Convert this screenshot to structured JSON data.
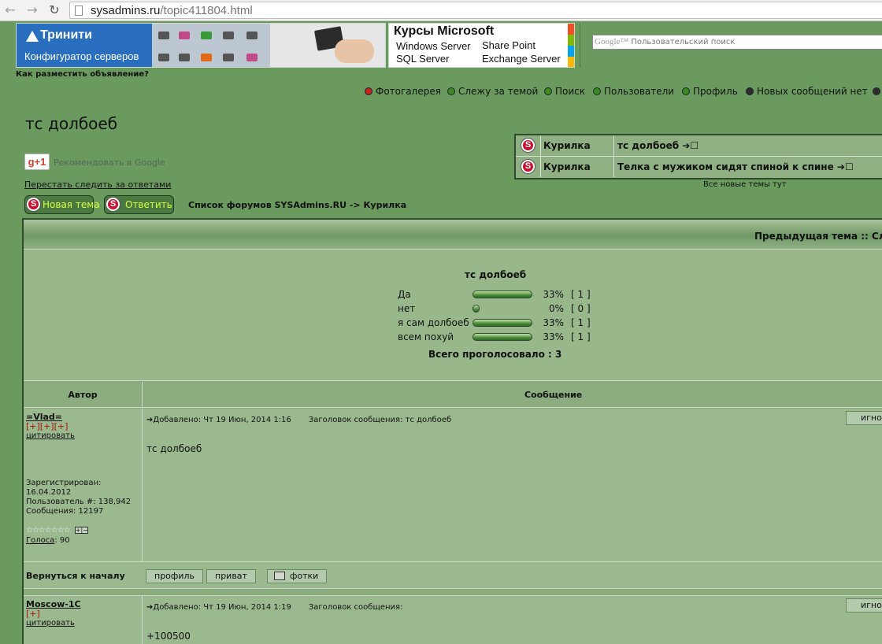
{
  "browser": {
    "url_domain": "sysadmins.ru",
    "url_path": "/topic411804.html",
    "back_glyph": "←",
    "forward_glyph": "→",
    "reload_glyph": "↻"
  },
  "ads": {
    "left_title": "Тринити",
    "left_sub": "Конфигуратор серверов",
    "mid_title": "Курсы Microsoft",
    "mid_items": [
      "Windows Server",
      "Share Point",
      "SQL Server",
      "Exchange Server"
    ],
    "search_logo": "Google™",
    "search_placeholder": "Пользовательский поиск",
    "how_to_post": "Как разместить объявление?"
  },
  "nav": {
    "items": [
      {
        "label": "Фотогалерея",
        "icon": "photo-gallery-icon",
        "color": "#c0261f"
      },
      {
        "label": "Слежу за темой",
        "icon": "watch-topic-icon",
        "color": "#3a8a1f"
      },
      {
        "label": "Поиск",
        "icon": "search-icon",
        "color": "#3a8a1f"
      },
      {
        "label": "Пользователи",
        "icon": "users-icon",
        "color": "#3a8a1f"
      },
      {
        "label": "Профиль",
        "icon": "profile-icon",
        "color": "#3a8a1f"
      },
      {
        "label": "Новых сообщений нет",
        "icon": "messages-icon",
        "color": "#2e2e2e"
      }
    ]
  },
  "topic": {
    "title": "тс долбоеб",
    "gplus": "g+1",
    "gplus_label": "Рекомендовать в Google",
    "unwatch": "Перестать следить за ответами",
    "new_topic_btn": "Новая тема",
    "reply_btn": "Ответить",
    "breadcrumb": "Список форумов SYSAdmins.RU -> Курилка",
    "prev_next": "Предыдущая тема :: Сле"
  },
  "recent": {
    "rows": [
      {
        "forum": "Курилка",
        "topic": "тс долбоеб ➔☐"
      },
      {
        "forum": "Курилка",
        "topic": "Телка с мужиком сидят спиной к спине ➔☐"
      }
    ],
    "all_new": "Все новые темы тут"
  },
  "poll": {
    "title": "тс долбоеб",
    "options": [
      {
        "label": "Да",
        "percent_text": "33%",
        "count_text": "[ 1 ]",
        "fraction": 0.33
      },
      {
        "label": "нет",
        "percent_text": "0%",
        "count_text": "[ 0 ]",
        "fraction": 0.0
      },
      {
        "label": "я сам долбоеб",
        "percent_text": "33%",
        "count_text": "[ 1 ]",
        "fraction": 0.33
      },
      {
        "label": "всем похуй",
        "percent_text": "33%",
        "count_text": "[ 1 ]",
        "fraction": 0.33
      }
    ],
    "total": "Всего проголосовало : 3"
  },
  "table": {
    "col_author": "Автор",
    "col_message": "Сообщение"
  },
  "posts": [
    {
      "author": "=Vlad=",
      "rank": "[+][+][+]",
      "quote": "цитировать",
      "registered_label": "Зарегистрирован:",
      "registered": "16.04.2012",
      "user_no": "Пользователь #: 138,942",
      "messages": "Сообщения: 12197",
      "stars": "☆☆☆☆☆☆☆",
      "plusminus": "+|−",
      "votes_link": "Голоса",
      "votes_value": ": 90",
      "added": "➔Добавлено: Чт 19 Июн, 2014 1:16",
      "subject": "Заголовок сообщения: тс долбоеб",
      "ignore": "игнор",
      "body": "тс долбоеб"
    },
    {
      "author": "Moscow-1C",
      "rank": "[+]",
      "quote": "цитировать",
      "added": "➔Добавлено: Чт 19 Июн, 2014 1:19",
      "subject": "Заголовок сообщения:",
      "ignore": "игнор",
      "body": "+100500"
    }
  ],
  "backbar": {
    "back": "Вернуться к началу",
    "profile": "профиль",
    "private": "приват",
    "photos": "фотки"
  }
}
